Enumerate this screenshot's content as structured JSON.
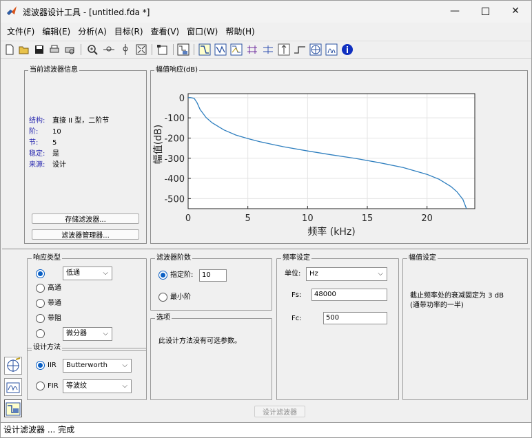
{
  "window": {
    "title": "滤波器设计工具 - [untitled.fda *]",
    "controls": [
      "minimize-icon",
      "maximize-icon",
      "close-icon"
    ]
  },
  "menu": [
    "文件(F)",
    "编辑(E)",
    "分析(A)",
    "目标(R)",
    "查看(V)",
    "窗口(W)",
    "帮助(H)"
  ],
  "toolbar_icons": [
    "new-icon",
    "open-icon",
    "save-icon",
    "print-icon",
    "print-preview-icon",
    "zoom-in-icon",
    "zoom-x-icon",
    "zoom-y-icon",
    "full-view-icon",
    "new-figure-icon",
    "filter-spec-icon",
    "magnitude-icon",
    "phase-icon",
    "magnitude-phase-icon",
    "group-delay-icon",
    "phase-delay-icon",
    "impulse-icon",
    "step-icon",
    "pole-zero-icon",
    "coefficients-icon",
    "info-icon"
  ],
  "filter_info": {
    "title": "当前滤波器信息",
    "rows": [
      {
        "key": "结构:",
        "value": "直接 II 型，二阶节"
      },
      {
        "key": "阶:",
        "value": "10"
      },
      {
        "key": "节:",
        "value": "5"
      },
      {
        "key": "稳定:",
        "value": "是"
      },
      {
        "key": "来源:",
        "value": "设计"
      }
    ],
    "store_button": "存储滤波器...",
    "manager_button": "滤波器管理器..."
  },
  "chart_panel_title": "幅值响应(dB)",
  "chart_data": {
    "type": "line",
    "xlabel": "频率 (kHz)",
    "ylabel": "幅值(dB)",
    "xlim": [
      0,
      24
    ],
    "ylim": [
      -550,
      20
    ],
    "xticks": [
      0,
      5,
      10,
      15,
      20
    ],
    "yticks": [
      0,
      -100,
      -200,
      -300,
      -400,
      -500
    ],
    "grid": true,
    "color": "#2f7fbf",
    "series": [
      {
        "x": [
          0,
          0.25,
          0.5,
          0.75,
          1,
          1.5,
          2,
          3,
          4,
          5,
          6,
          7,
          8,
          10,
          12,
          14,
          16,
          18,
          20,
          21,
          22,
          22.5,
          23,
          23.3
        ],
        "y": [
          0,
          0,
          -3,
          -25,
          -58,
          -98,
          -124,
          -160,
          -185,
          -203,
          -218,
          -231,
          -243,
          -264,
          -283,
          -301,
          -322,
          -346,
          -380,
          -404,
          -440,
          -466,
          -504,
          -550
        ]
      }
    ]
  },
  "response_type": {
    "title": "响应类型",
    "options": [
      "低通",
      "高通",
      "带通",
      "带阻",
      "微分器"
    ],
    "lowpass_select": "低通",
    "other_select": "微分器",
    "selected": 0
  },
  "design_method": {
    "title": "设计方法",
    "iir_label": "IIR",
    "iir_select": "Butterworth",
    "fir_label": "FIR",
    "fir_select": "等波纹",
    "selected": "IIR"
  },
  "filter_order": {
    "title": "滤波器阶数",
    "specify_label": "指定阶:",
    "specify_value": "10",
    "minimum_label": "最小阶",
    "selected": "specify"
  },
  "options": {
    "title": "选项",
    "text": "此设计方法没有可选参数。"
  },
  "freq_spec": {
    "title": "频率设定",
    "units_label": "单位:",
    "units_value": "Hz",
    "fs_label": "Fs:",
    "fs_value": "48000",
    "fc_label": "Fc:",
    "fc_value": "500"
  },
  "mag_spec": {
    "title": "幅值设定",
    "text_line1": "截止频率处的衰减固定为 3 dB",
    "text_line2": "(通带功率的一半)"
  },
  "design_button": "设计滤波器",
  "status": "设计滤波器 ... 完成"
}
